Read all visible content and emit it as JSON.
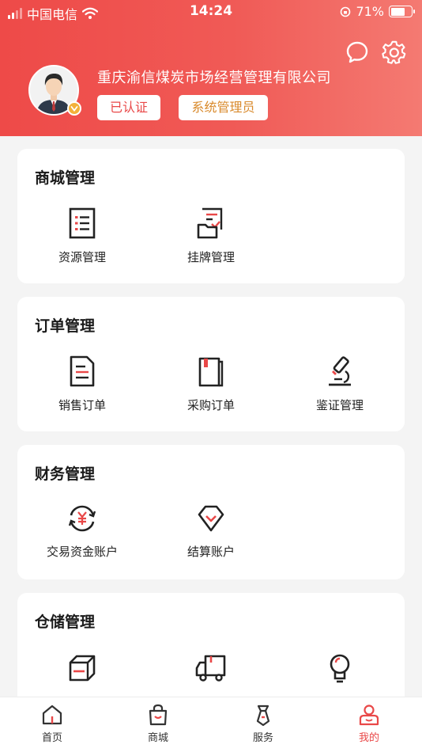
{
  "status_bar": {
    "carrier": "中国电信",
    "time": "14:24",
    "battery": "71%",
    "battery_level": 0.71
  },
  "header": {
    "company": "重庆渝信煤炭市场经营管理有限公司",
    "tags": [
      "已认证",
      "系统管理员"
    ],
    "icons": [
      "message-icon",
      "settings-icon"
    ]
  },
  "sections": [
    {
      "title": "商城管理",
      "items": [
        {
          "label": "资源管理",
          "icon": "list-doc-icon"
        },
        {
          "label": "挂牌管理",
          "icon": "listing-folder-icon"
        }
      ]
    },
    {
      "title": "订单管理",
      "items": [
        {
          "label": "销售订单",
          "icon": "sales-doc-icon"
        },
        {
          "label": "采购订单",
          "icon": "purchase-book-icon"
        },
        {
          "label": "鉴证管理",
          "icon": "microscope-icon"
        }
      ]
    },
    {
      "title": "财务管理",
      "items": [
        {
          "label": "交易资金账户",
          "icon": "yuan-exchange-icon"
        },
        {
          "label": "结算账户",
          "icon": "diamond-account-icon"
        }
      ]
    },
    {
      "title": "仓储管理",
      "items": [
        {
          "icon": "warehouse-box-icon"
        },
        {
          "icon": "truck-icon"
        },
        {
          "icon": "bulb-icon"
        }
      ]
    }
  ],
  "tabbar": [
    {
      "label": "首页",
      "icon": "home-icon"
    },
    {
      "label": "商城",
      "icon": "shopping-bag-icon"
    },
    {
      "label": "服务",
      "icon": "service-tie-icon"
    },
    {
      "label": "我的",
      "icon": "profile-icon",
      "active": true
    }
  ],
  "colors": {
    "accent": "#e94848",
    "header_gradient": [
      "#ee4a48",
      "#f47a72"
    ],
    "tag_gold": "#d98a2c"
  }
}
